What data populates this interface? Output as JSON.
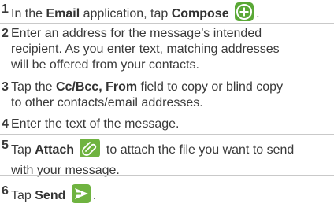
{
  "steps": [
    {
      "number": "1",
      "t1": "In the ",
      "b1": "Email",
      "t2": " application, tap ",
      "b2": "Compose",
      "icon": "compose-plus-icon",
      "t3": "."
    },
    {
      "number": "2",
      "line1": "Enter an address for the message’s intended",
      "line2": "recipient. As you enter text, matching addresses",
      "line3": "will be offered from your contacts."
    },
    {
      "number": "3",
      "t1": "Tap the ",
      "b1": "Cc/Bcc, From",
      "t2": " field to copy or blind copy",
      "line2": "to other contacts/email addresses."
    },
    {
      "number": "4",
      "line1": "Enter the text of the message."
    },
    {
      "number": "5",
      "t1": "Tap ",
      "b1": "Attach",
      "icon": "paperclip-icon",
      "t2": " to attach the file you want to send",
      "line2": "with your message."
    },
    {
      "number": "6",
      "t1": "Tap ",
      "b1": "Send",
      "icon": "send-arrow-icon",
      "t2": "."
    }
  ],
  "colors": {
    "text": "#3a3a3a",
    "compose_icon_green": "#5aa836",
    "attach_icon_green": "#6fb340",
    "send_icon_green": "#6fb340",
    "separator": "#c9c9c9"
  }
}
